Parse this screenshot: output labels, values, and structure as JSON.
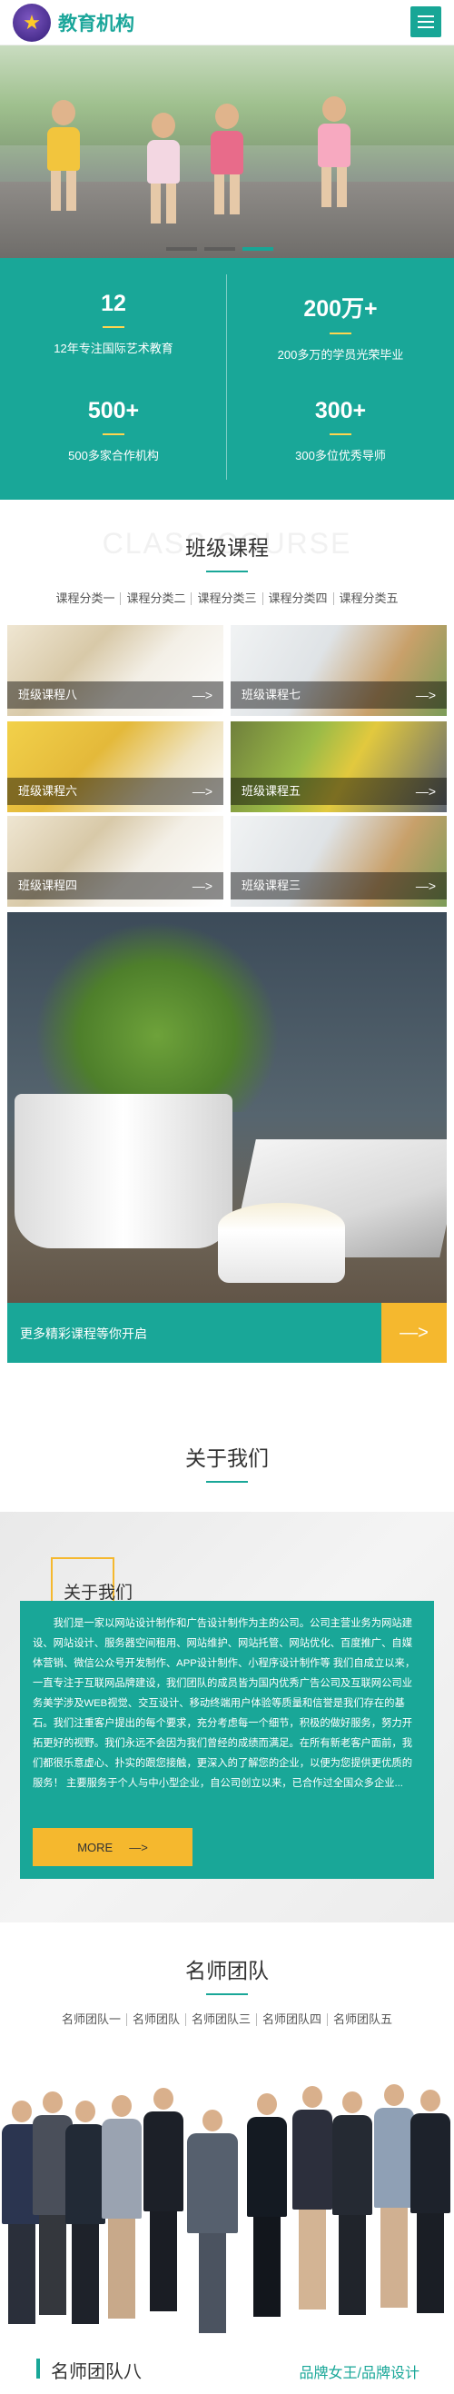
{
  "header": {
    "brand": "教育机构",
    "colors": {
      "accent": "#19a798",
      "highlight": "#f5b82e"
    }
  },
  "stats": [
    {
      "num": "12",
      "text": "12年专注国际艺术教育"
    },
    {
      "num": "200万+",
      "text": "200多万的学员光荣毕业"
    },
    {
      "num": "500+",
      "text": "500多家合作机构"
    },
    {
      "num": "300+",
      "text": "300多位优秀导师"
    }
  ],
  "courses_section": {
    "title": "班级课程",
    "title_en": "CLASS COURSE",
    "tabs": [
      "课程分类一",
      "课程分类二",
      "课程分类三",
      "课程分类四",
      "课程分类五"
    ],
    "items": [
      {
        "label": "班级课程八",
        "arrow": "—>"
      },
      {
        "label": "班级课程七",
        "arrow": "—>"
      },
      {
        "label": "班级课程六",
        "arrow": "—>"
      },
      {
        "label": "班级课程五",
        "arrow": "—>"
      },
      {
        "label": "班级课程四",
        "arrow": "—>"
      },
      {
        "label": "班级课程三",
        "arrow": "—>"
      }
    ],
    "more_text": "更多精彩课程等你开启",
    "more_arrow": "—>"
  },
  "about": {
    "title": "关于我们",
    "label": "关于我们",
    "body": "我们是一家以网站设计制作和广告设计制作为主的公司。公司主营业务为网站建设、网站设计、服务器空间租用、网站维护、网站托管、网站优化、百度推广、自媒体营销、微信公众号开发制作、APP设计制作、小程序设计制作等 我们自成立以来，一直专注于互联网品牌建设，我们团队的成员皆为国内优秀广告公司及互联网公司业务美学涉及WEB视觉、交互设计、移动终端用户体验等质量和信誉是我们存在的基石。我们注重客户提出的每个要求，充分考虑每一个细节，积极的做好服务，努力开拓更好的视野。我们永远不会因为我们曾经的成绩而满足。在所有新老客户面前，我们都很乐意虚心、扑实的跟您接触，更深入的了解您的企业，以便为您提供更优质的服务！ 主要服务于个人与中小型企业，自公司创立以来，已合作过全国众多企业...",
    "more_label": "MORE",
    "more_arrow": "—>"
  },
  "team_section": {
    "title": "名师团队",
    "tabs": [
      "名师团队一",
      "名师团队",
      "名师团队三",
      "名师团队四",
      "名师团队五"
    ],
    "current_title": "名师团队八",
    "current_subtitle": "品牌女王/品牌设计"
  }
}
